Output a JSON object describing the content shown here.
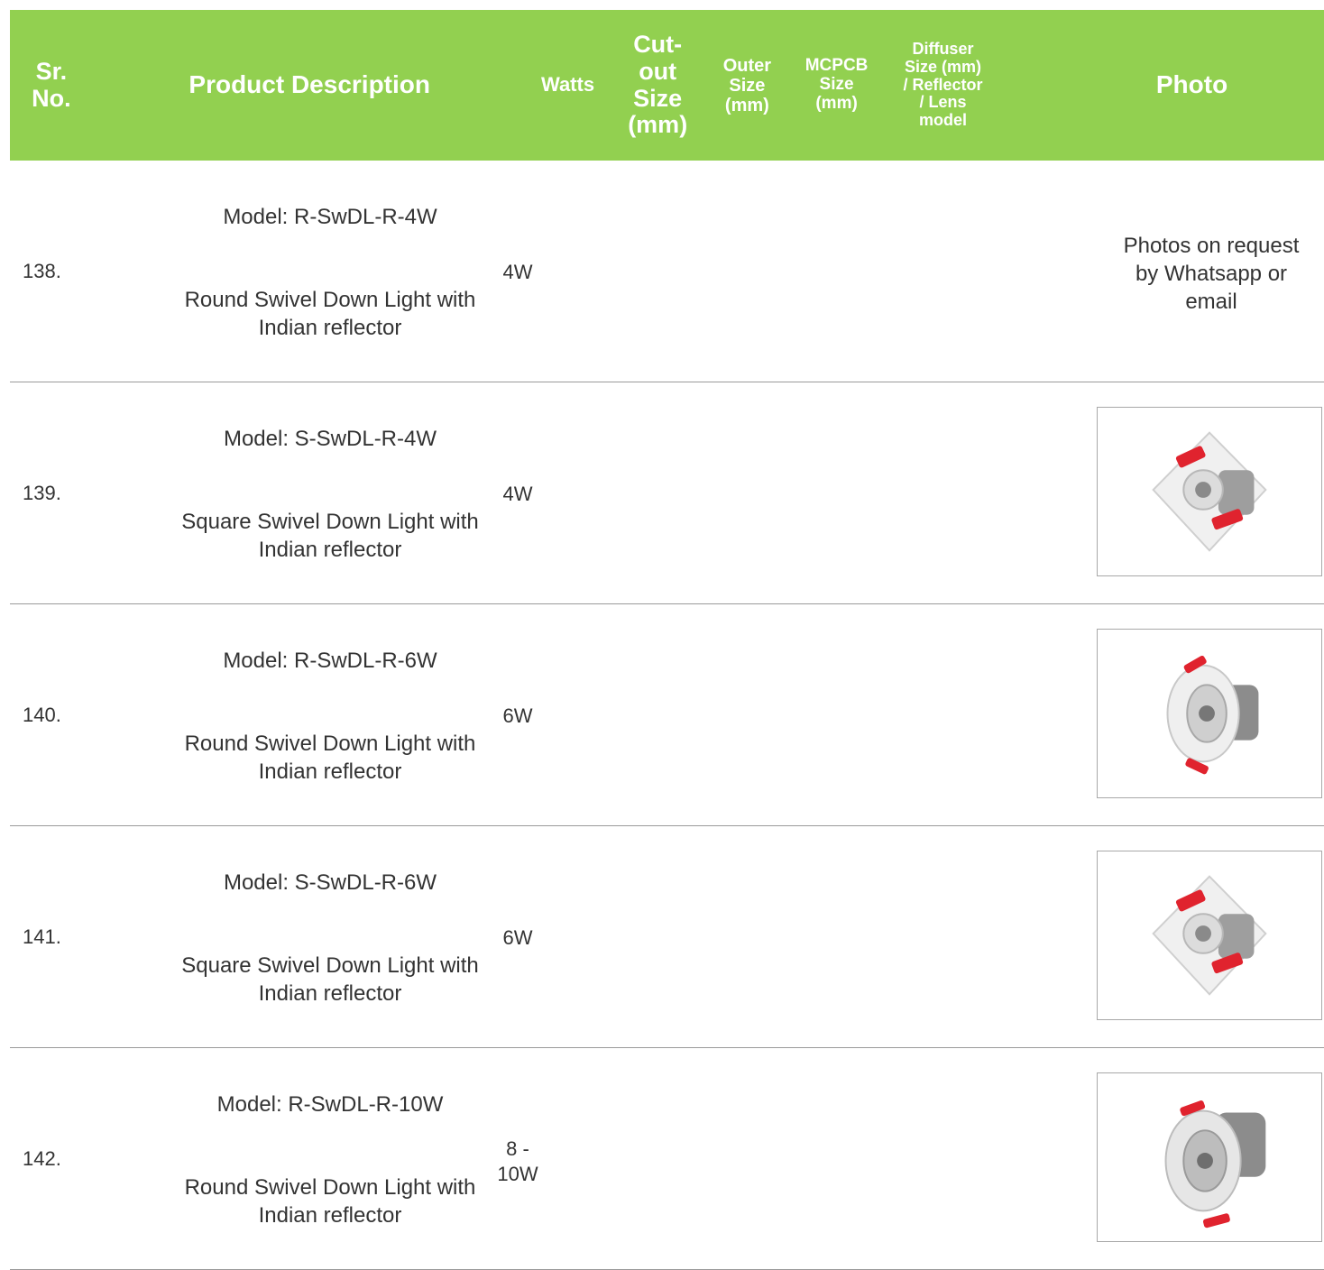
{
  "header": {
    "sr_no": "Sr.\nNo.",
    "product_description": "Product Description",
    "watts": "Watts",
    "cutout_size": "Cut-\nout\nSize\n(mm)",
    "outer_size": "Outer\nSize\n(mm)",
    "mcpcb_size": "MCPCB\nSize\n(mm)",
    "diffuser": "Diffuser\nSize (mm)\n/ Reflector\n/ Lens\nmodel",
    "photo": "Photo"
  },
  "rows": [
    {
      "sr": "138.",
      "model": "Model: R-SwDL-R-4W",
      "description": "Round Swivel Down Light with\nIndian reflector",
      "watts": "4W",
      "photo_note": "Photos on request\nby Whatsapp or\nemail",
      "photo_shape": "none"
    },
    {
      "sr": "139.",
      "model": "Model: S-SwDL-R-4W",
      "description": "Square Swivel Down Light with\nIndian reflector",
      "watts": "4W",
      "photo_note": "",
      "photo_shape": "square"
    },
    {
      "sr": "140.",
      "model": "Model: R-SwDL-R-6W",
      "description": "Round Swivel Down Light with\nIndian reflector",
      "watts": "6W",
      "photo_note": "",
      "photo_shape": "round"
    },
    {
      "sr": "141.",
      "model": "Model: S-SwDL-R-6W",
      "description": "Square Swivel Down Light with\nIndian reflector",
      "watts": "6W",
      "photo_note": "",
      "photo_shape": "square"
    },
    {
      "sr": "142.",
      "model": "Model: R-SwDL-R-10W",
      "description": "Round Swivel Down Light with\nIndian reflector",
      "watts": "8 -\n10W",
      "photo_note": "",
      "photo_shape": "round-large"
    }
  ],
  "colors": {
    "header_bg": "#92d050",
    "header_text": "#ffffff",
    "clip_red": "#e0232e"
  }
}
